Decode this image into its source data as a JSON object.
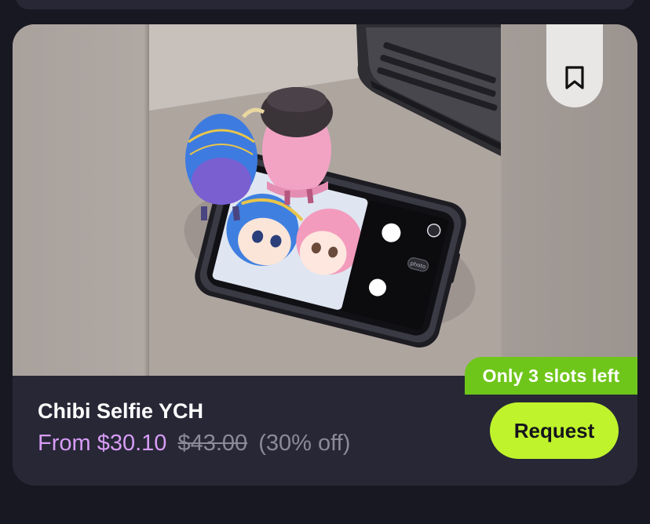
{
  "listing": {
    "title": "Chibi Selfie YCH",
    "price_from": "From $30.10",
    "price_original": "$43.00",
    "price_discount": "(30% off)",
    "slots_badge": "Only 3 slots left",
    "request_label": "Request",
    "bookmark_icon": "bookmark-icon",
    "phone_button_text": "photo"
  },
  "colors": {
    "background": "#181822",
    "card": "#272736",
    "price_accent": "#d79cf5",
    "badge": "#6fc61a",
    "request_button": "#bff32c"
  }
}
